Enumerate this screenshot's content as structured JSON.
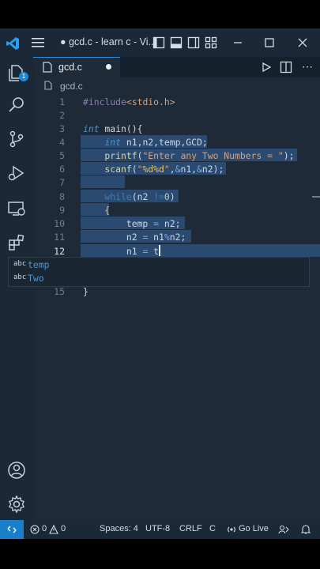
{
  "window": {
    "title": "● gcd.c - learn c - Vi..."
  },
  "tab": {
    "label": "gcd.c"
  },
  "breadcrumb": {
    "file": "gcd.c"
  },
  "activity": {
    "explorer_badge": "1"
  },
  "editor": {
    "lines": [
      {
        "n": "1",
        "tokens": [
          {
            "t": "#include",
            "c": "pp"
          },
          {
            "t": "<stdio.h>",
            "c": "str2"
          }
        ]
      },
      {
        "n": "2",
        "tokens": []
      },
      {
        "n": "3",
        "tokens": [
          {
            "t": "int",
            "c": "kw"
          },
          {
            "t": " main(){",
            "c": ""
          }
        ]
      },
      {
        "n": "4",
        "tokens": [
          {
            "t": "    int",
            "c": "kw"
          },
          {
            "t": " n1,n2,temp,GCD;",
            "c": ""
          }
        ]
      },
      {
        "n": "5",
        "tokens": [
          {
            "t": "    printf",
            "c": "fn"
          },
          {
            "t": "(",
            "c": ""
          },
          {
            "t": "\"Enter any Two Numbers = \"",
            "c": "str"
          },
          {
            "t": ");",
            "c": ""
          }
        ]
      },
      {
        "n": "6",
        "tokens": [
          {
            "t": "    scanf",
            "c": "fn"
          },
          {
            "t": "(",
            "c": ""
          },
          {
            "t": "\"",
            "c": "str"
          },
          {
            "t": "%d%d",
            "c": "fmt"
          },
          {
            "t": "\"",
            "c": "str"
          },
          {
            "t": ",",
            "c": ""
          },
          {
            "t": "&",
            "c": "op"
          },
          {
            "t": "n1,",
            "c": ""
          },
          {
            "t": "&",
            "c": "op"
          },
          {
            "t": "n2);",
            "c": ""
          }
        ]
      },
      {
        "n": "7",
        "tokens": []
      },
      {
        "n": "8",
        "tokens": [
          {
            "t": "    while",
            "c": "dim"
          },
          {
            "t": "(n2 ",
            "c": ""
          },
          {
            "t": "!=",
            "c": "dim"
          },
          {
            "t": "0",
            "c": "num"
          },
          {
            "t": ")",
            "c": ""
          }
        ]
      },
      {
        "n": "9",
        "tokens": [
          {
            "t": "    {",
            "c": "fmt"
          }
        ]
      },
      {
        "n": "10",
        "tokens": [
          {
            "t": "        temp ",
            "c": ""
          },
          {
            "t": "=",
            "c": "op"
          },
          {
            "t": " n2;",
            "c": ""
          }
        ]
      },
      {
        "n": "11",
        "tokens": [
          {
            "t": "        n2 ",
            "c": ""
          },
          {
            "t": "=",
            "c": "op"
          },
          {
            "t": " n1",
            "c": ""
          },
          {
            "t": "%",
            "c": "op"
          },
          {
            "t": "n2;",
            "c": ""
          }
        ]
      },
      {
        "n": "12",
        "tokens": [
          {
            "t": "        n1 ",
            "c": ""
          },
          {
            "t": "=",
            "c": "op"
          },
          {
            "t": " t",
            "c": ""
          }
        ]
      },
      {
        "n": "15",
        "tokens": [
          {
            "t": "}",
            "c": ""
          }
        ]
      }
    ],
    "suggestions": [
      {
        "kind": "abc",
        "label": "temp"
      },
      {
        "kind": "abc",
        "label": "Two"
      }
    ]
  },
  "status": {
    "errors": "0",
    "warnings": "0",
    "spaces": "Spaces: 4",
    "encoding": "UTF-8",
    "eol": "CRLF",
    "language": "C",
    "golive": "Go Live"
  },
  "colors": {
    "accent": "#1a7fc9",
    "editor_bg": "#1e2a38",
    "chrome_bg": "#1b2838",
    "selection": "#2a4a72"
  }
}
